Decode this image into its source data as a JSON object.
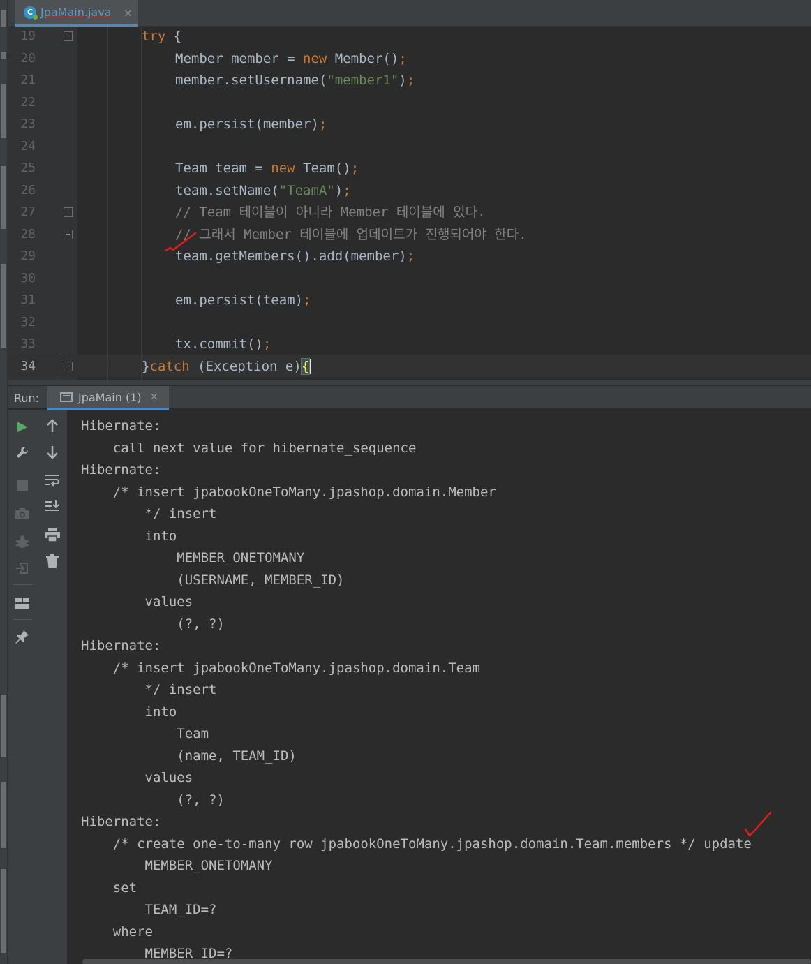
{
  "editor": {
    "tab": {
      "filename": "JpaMain.java",
      "close": "×"
    },
    "lines": [
      {
        "num": "19",
        "segments": [
          [
            "kw",
            "try"
          ],
          [
            "",
            " {"
          ]
        ]
      },
      {
        "num": "20",
        "segments": [
          [
            "",
            "Member member = "
          ],
          [
            "kw",
            "new"
          ],
          [
            "",
            " Member()"
          ],
          [
            "kw",
            ";"
          ]
        ]
      },
      {
        "num": "21",
        "segments": [
          [
            "",
            "member.setUsername("
          ],
          [
            "str",
            "\"member1\""
          ],
          [
            "",
            ")"
          ],
          [
            "kw",
            ";"
          ]
        ]
      },
      {
        "num": "22",
        "segments": []
      },
      {
        "num": "23",
        "segments": [
          [
            "",
            "em.persist(member)"
          ],
          [
            "kw",
            ";"
          ]
        ]
      },
      {
        "num": "24",
        "segments": []
      },
      {
        "num": "25",
        "segments": [
          [
            "",
            "Team team = "
          ],
          [
            "kw",
            "new"
          ],
          [
            "",
            " Team()"
          ],
          [
            "kw",
            ";"
          ]
        ]
      },
      {
        "num": "26",
        "segments": [
          [
            "",
            "team.setName("
          ],
          [
            "str",
            "\"TeamA\""
          ],
          [
            "",
            ")"
          ],
          [
            "kw",
            ";"
          ]
        ]
      },
      {
        "num": "27",
        "segments": [
          [
            "cm",
            "// Team 테이블이 아니라 Member 테이블에 있다."
          ]
        ]
      },
      {
        "num": "28",
        "segments": [
          [
            "cm",
            "// 그래서 Member 테이블에 업데이트가 진행되어야 한다."
          ]
        ]
      },
      {
        "num": "29",
        "segments": [
          [
            "",
            "team.getMembers().add(member)"
          ],
          [
            "kw",
            ";"
          ]
        ]
      },
      {
        "num": "30",
        "segments": []
      },
      {
        "num": "31",
        "segments": [
          [
            "",
            "em.persist(team)"
          ],
          [
            "kw",
            ";"
          ]
        ]
      },
      {
        "num": "32",
        "segments": []
      },
      {
        "num": "33",
        "segments": [
          [
            "",
            "tx.commit()"
          ],
          [
            "kw",
            ";"
          ]
        ]
      },
      {
        "num": "34",
        "segments": [
          [
            "",
            "}"
          ],
          [
            "kw",
            "catch"
          ],
          [
            "",
            " (Exception e)"
          ],
          [
            "brace",
            "{"
          ]
        ]
      }
    ]
  },
  "run": {
    "label": "Run:",
    "tab_name": "JpaMain (1)",
    "tab_close": "×",
    "console": [
      "Hibernate: ",
      "    call next value for hibernate_sequence",
      "Hibernate: ",
      "    /* insert jpabookOneToMany.jpashop.domain.Member",
      "        */ insert ",
      "        into",
      "            MEMBER_ONETOMANY",
      "            (USERNAME, MEMBER_ID) ",
      "        values",
      "            (?, ?)",
      "Hibernate: ",
      "    /* insert jpabookOneToMany.jpashop.domain.Team",
      "        */ insert ",
      "        into",
      "            Team",
      "            (name, TEAM_ID) ",
      "        values",
      "            (?, ?)",
      "Hibernate: ",
      "    /* create one-to-many row jpabookOneToMany.jpashop.domain.Team.members */ update",
      "        MEMBER_ONETOMANY ",
      "    set",
      "        TEAM_ID=? ",
      "    where",
      "        MEMBER_ID=?"
    ]
  },
  "colors": {
    "keyword": "#cc7832",
    "string": "#6a8759",
    "comment": "#808080",
    "annotation_mark": "#e01b1b"
  },
  "icons": {
    "run_toolbar_left": [
      "rerun-icon",
      "wrench-icon",
      "stop-icon",
      "camera-icon",
      "debug-icon",
      "exit-icon",
      "layout-icon",
      "pin-icon"
    ],
    "run_toolbar_right": [
      "arrow-up-icon",
      "arrow-down-icon",
      "soft-wrap-icon",
      "scroll-to-end-icon",
      "print-icon",
      "trash-icon"
    ]
  }
}
